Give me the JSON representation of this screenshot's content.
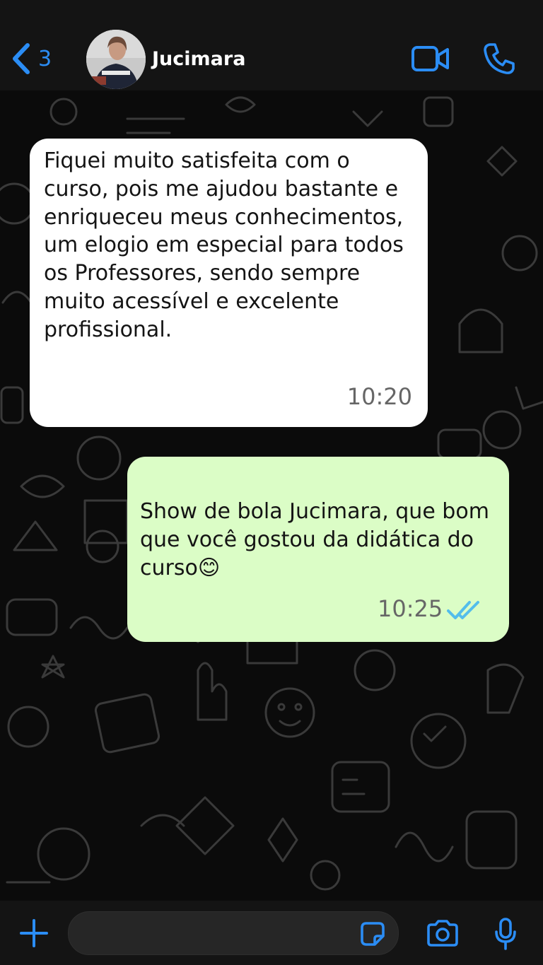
{
  "header": {
    "back_count": "3",
    "contact_name": "Jucimara",
    "accent_color": "#2b8df5",
    "icons": [
      "chevron-left-icon",
      "video-call-icon",
      "phone-icon"
    ]
  },
  "messages": [
    {
      "direction": "incoming",
      "text": "Fiquei muito satisfeita com o curso, pois me ajudou bastante e enriqueceu meus conhecimentos, um elogio em especial para todos os Professores, sendo sempre muito acessível e excelente profissional.",
      "time": "10:20",
      "bubble_color": "#ffffff"
    },
    {
      "direction": "outgoing",
      "text": "Show de bola Jucimara, que bom que você gostou da didática do curso😊",
      "time": "10:25",
      "status": "read",
      "bubble_color": "#dbfdc6",
      "tick_color": "#53bdeb"
    }
  ],
  "composer": {
    "placeholder": "",
    "icons": [
      "plus-icon",
      "sticker-icon",
      "camera-icon",
      "microphone-icon"
    ]
  }
}
